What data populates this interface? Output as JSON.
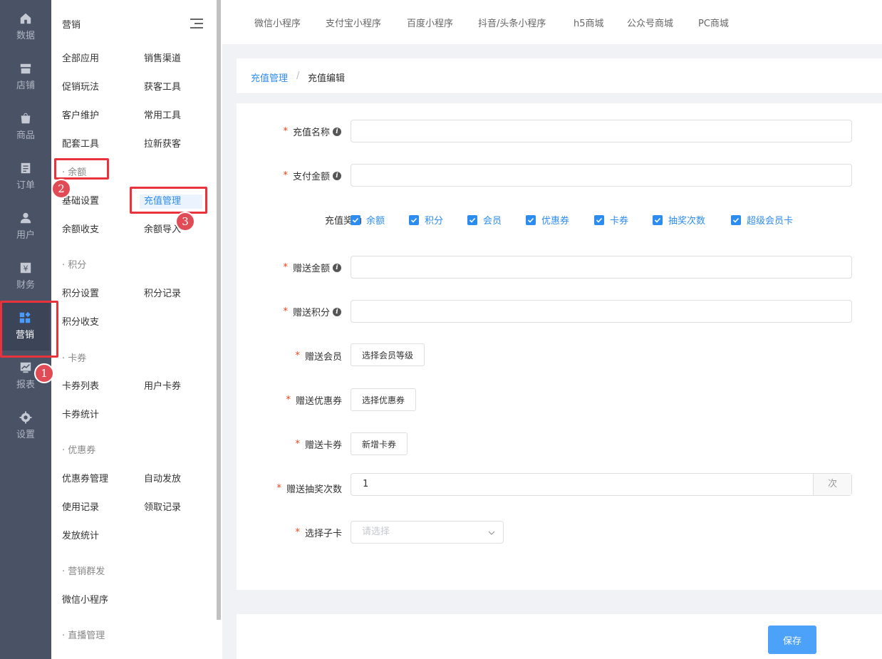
{
  "rail": {
    "items": [
      {
        "label": "数据",
        "icon": "home-icon"
      },
      {
        "label": "店铺",
        "icon": "store-icon"
      },
      {
        "label": "商品",
        "icon": "bag-icon"
      },
      {
        "label": "订单",
        "icon": "order-icon"
      },
      {
        "label": "用户",
        "icon": "user-icon"
      },
      {
        "label": "财务",
        "icon": "finance-icon"
      },
      {
        "label": "营销",
        "icon": "marketing-icon",
        "active": true
      },
      {
        "label": "报表",
        "icon": "chart-icon"
      },
      {
        "label": "设置",
        "icon": "gear-icon"
      }
    ]
  },
  "submenu": {
    "title": "营销",
    "items": {
      "all_apps": "全部应用",
      "sales_channel": "销售渠道",
      "promo": "促销玩法",
      "acquire": "获客工具",
      "customer": "客户维护",
      "common": "常用工具",
      "support": "配套工具",
      "new_customers": "拉新获客",
      "sec_balance": "· 余额",
      "basic_settings": "基础设置",
      "recharge_mgmt": "充值管理",
      "balance_io": "余额收支",
      "balance_import": "余额导入",
      "sec_points": "· 积分",
      "points_settings": "积分设置",
      "points_record": "积分记录",
      "points_io": "积分收支",
      "sec_cards": "· 卡券",
      "card_list": "卡券列表",
      "user_cards": "用户卡券",
      "card_stats": "卡券统计",
      "sec_coupons": "· 优惠券",
      "coupon_mgmt": "优惠券管理",
      "auto_issue": "自动发放",
      "usage_record": "使用记录",
      "claim_record": "领取记录",
      "issue_stats": "发放统计",
      "sec_mass": "· 营销群发",
      "wx_mini": "微信小程序",
      "sec_live": "· 直播管理"
    }
  },
  "annotations": [
    "1",
    "2",
    "3"
  ],
  "tabs": [
    "微信小程序",
    "支付宝小程序",
    "百度小程序",
    "抖音/头条小程序",
    "h5商城",
    "公众号商城",
    "PC商城"
  ],
  "breadcrumb": {
    "parent": "充值管理",
    "sep": "/",
    "current": "充值编辑"
  },
  "form": {
    "name_label": "充值名称",
    "pay_label": "支付金额",
    "reward_label": "充值奖励",
    "rewards": [
      "余额",
      "积分",
      "会员",
      "优惠券",
      "卡券",
      "抽奖次数",
      "超级会员卡"
    ],
    "gift_amount_label": "赠送金额",
    "gift_points_label": "赠送积分",
    "gift_member_label": "赠送会员",
    "gift_member_btn": "选择会员等级",
    "gift_coupon_label": "赠送优惠券",
    "gift_coupon_btn": "选择优惠券",
    "gift_card_label": "赠送卡券",
    "gift_card_btn": "新增卡券",
    "lottery_label": "赠送抽奖次数",
    "lottery_value": "1",
    "lottery_unit": "次",
    "subcard_label": "选择子卡",
    "subcard_placeholder": "请选择",
    "required_mark": "*",
    "info_mark": "i"
  },
  "footer": {
    "save": "保存"
  },
  "colors": {
    "accent": "#2d8cf0",
    "rail_bg": "#4a5366",
    "annotation": "#e8323c",
    "save": "#4ba2f8"
  }
}
